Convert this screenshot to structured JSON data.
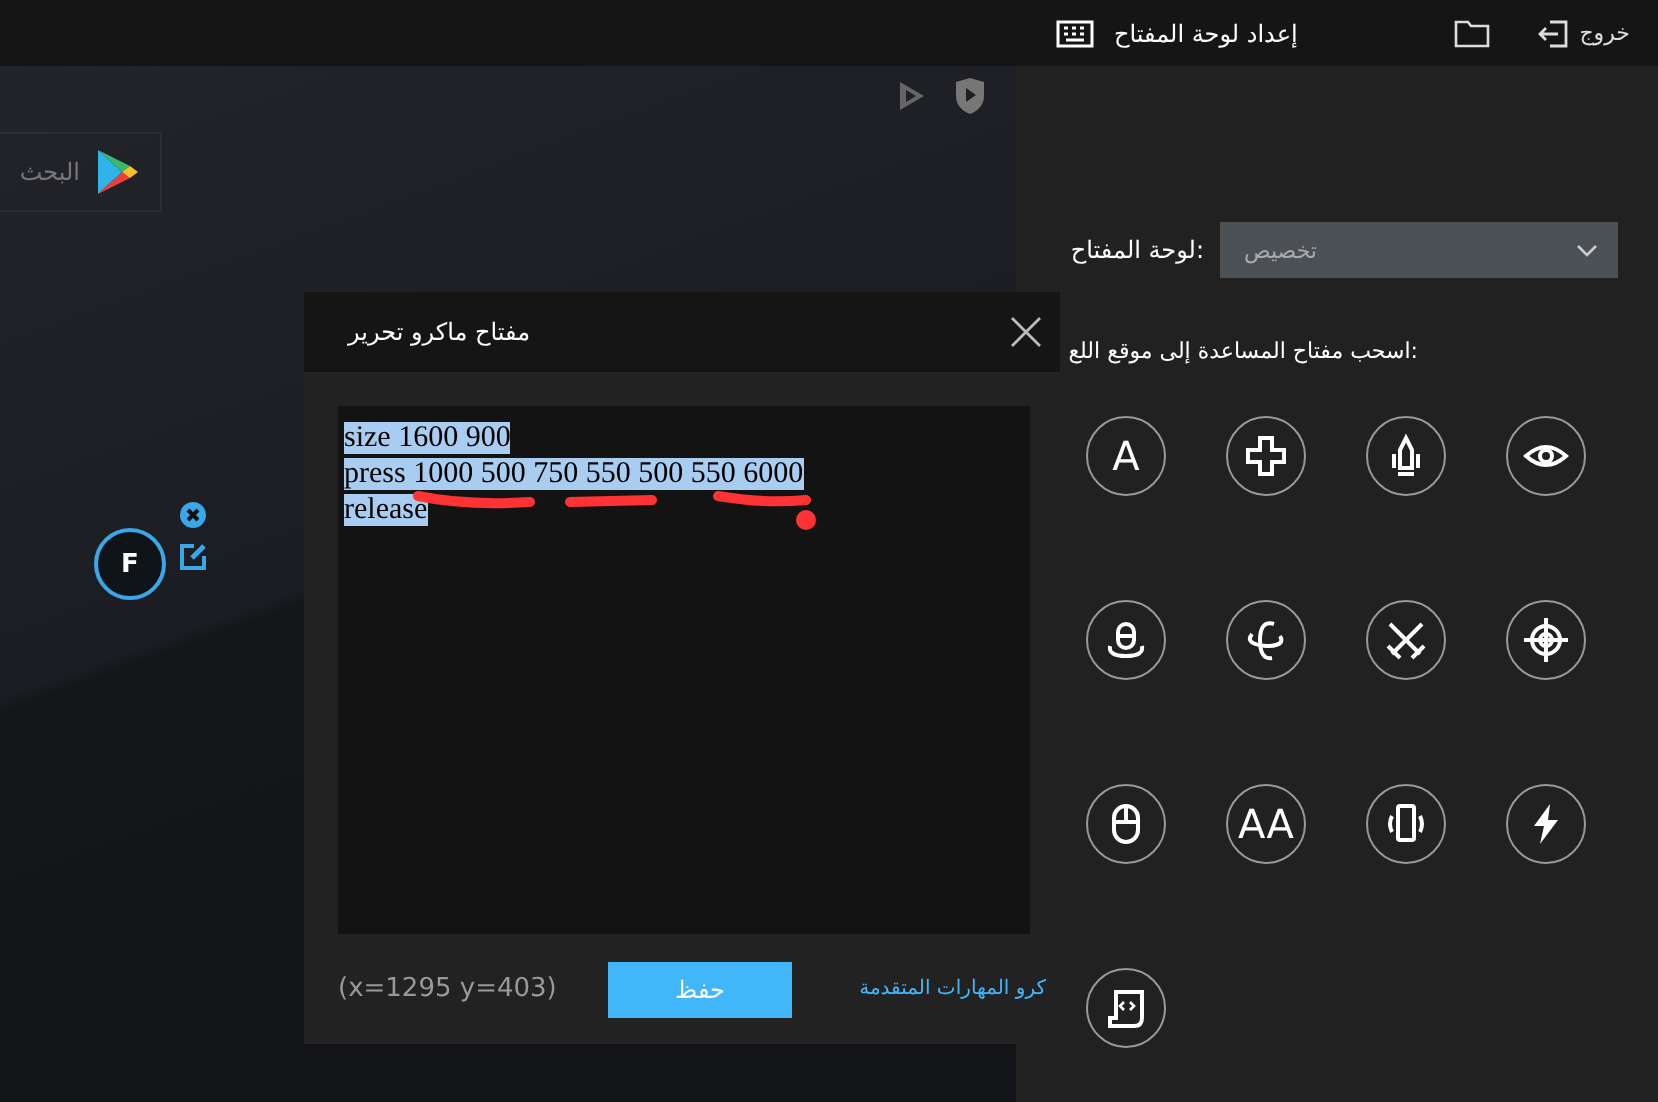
{
  "left": {
    "search": {
      "placeholder": "البحث"
    },
    "key_marker": {
      "label": "F"
    }
  },
  "panel": {
    "title": "إعداد لوحة المفتاح",
    "exit": "خروج",
    "keyboard_label": "لوحة المفتاح:",
    "keyboard_value": "تخصيص",
    "drag_hint": "اسحب مفتاح المساعدة إلى موقع اللع:",
    "tools": [
      {
        "kind": "letter",
        "label": "A"
      },
      {
        "kind": "cross"
      },
      {
        "kind": "bullet"
      },
      {
        "kind": "eye"
      },
      {
        "kind": "mouse-orbit"
      },
      {
        "kind": "orbit"
      },
      {
        "kind": "swords"
      },
      {
        "kind": "crosshair"
      },
      {
        "kind": "mouse"
      },
      {
        "kind": "letter",
        "label": "AA"
      },
      {
        "kind": "phone-rotate"
      },
      {
        "kind": "lightning"
      },
      {
        "kind": "script"
      }
    ]
  },
  "dialog": {
    "title": "مفتاح ماكرو تحرير",
    "lines": [
      {
        "text": "size 1600 900",
        "selected": true
      },
      {
        "text": "press 1000 500 750 550 500 550 6000",
        "selected": true
      },
      {
        "text": "release",
        "selected": true
      }
    ],
    "coords": "(x=1295  y=403)",
    "save": "حفظ",
    "link": "كرو المهارات المتقدمة"
  }
}
